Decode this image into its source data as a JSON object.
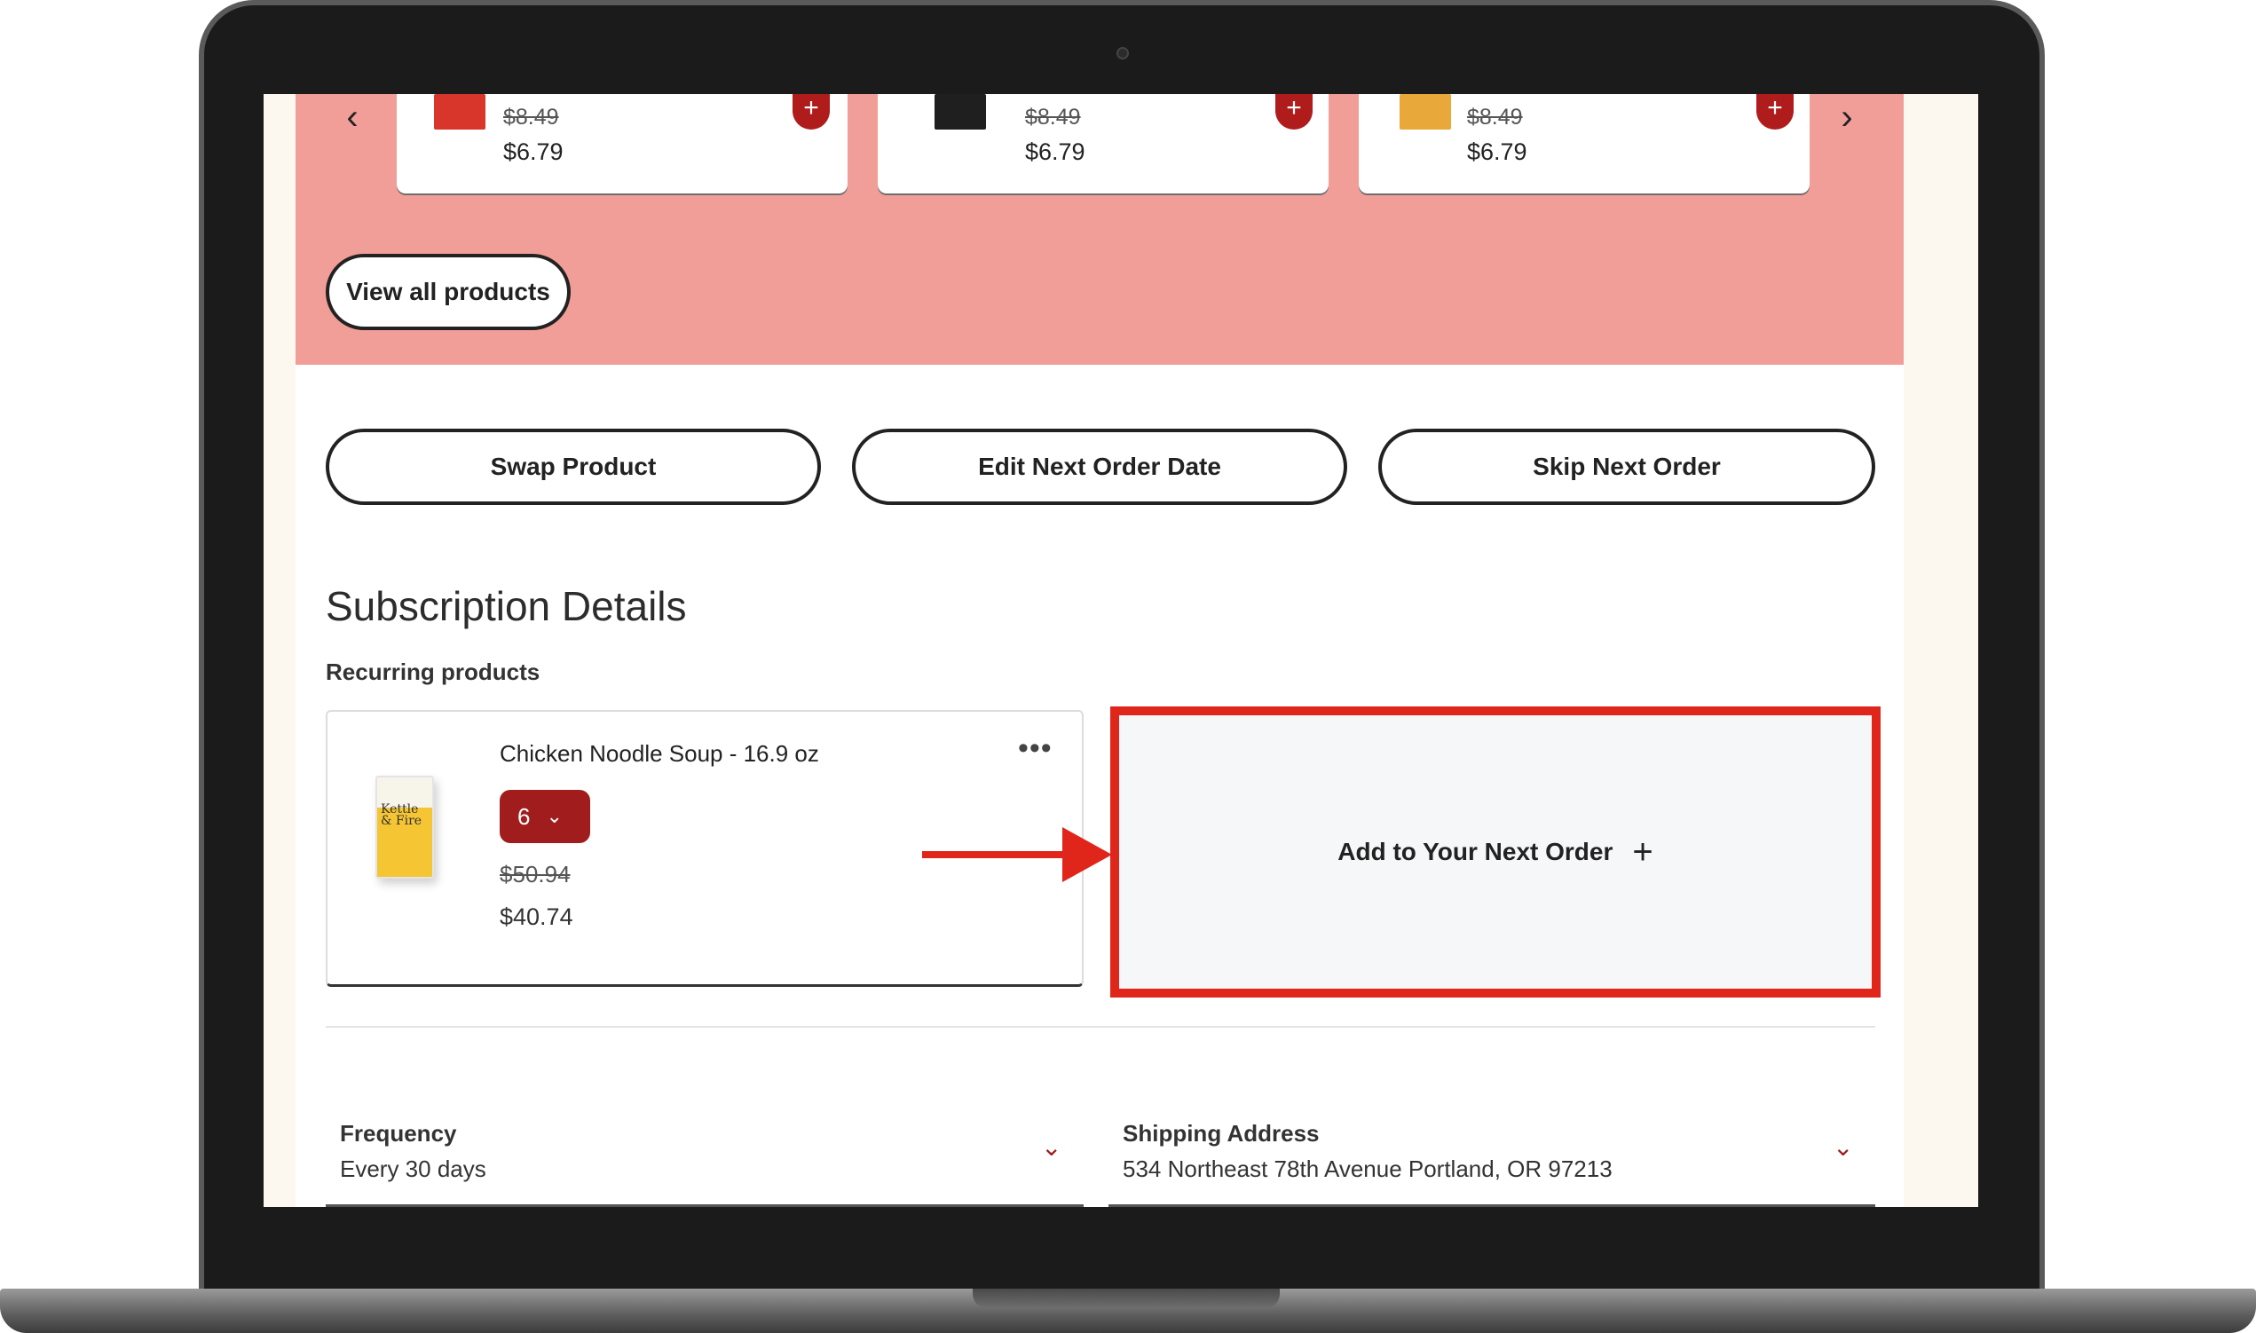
{
  "carousel": {
    "prev_glyph": "‹",
    "next_glyph": "›",
    "cards": [
      {
        "old_price": "$8.49",
        "new_price": "$6.79",
        "image_color": "#d8362a"
      },
      {
        "old_price": "$8.49",
        "new_price": "$6.79",
        "image_color": "#1f1f1f"
      },
      {
        "old_price": "$8.49",
        "new_price": "$6.79",
        "image_color": "#e8a83a"
      }
    ],
    "add_glyph": "+",
    "view_all_label": "View all products"
  },
  "actions": {
    "swap": "Swap Product",
    "edit_date": "Edit Next Order Date",
    "skip": "Skip Next Order"
  },
  "subscription": {
    "title": "Subscription Details",
    "recurring_label": "Recurring products",
    "product": {
      "name": "Chicken Noodle Soup - 16.9 oz",
      "box_text": "Kettle & Fire",
      "quantity": "6",
      "old_price": "$50.94",
      "new_price": "$40.74",
      "more_glyph": "•••"
    },
    "add_next_order": "Add to Your Next Order",
    "add_next_glyph": "+"
  },
  "frequency": {
    "label": "Frequency",
    "value": "Every 30 days"
  },
  "shipping": {
    "label": "Shipping Address",
    "value": "534 Northeast 78th Avenue Portland, OR 97213"
  },
  "colors": {
    "promo_bg": "#f29e98",
    "brand_red": "#a11d1d",
    "highlight": "#e0261a"
  }
}
